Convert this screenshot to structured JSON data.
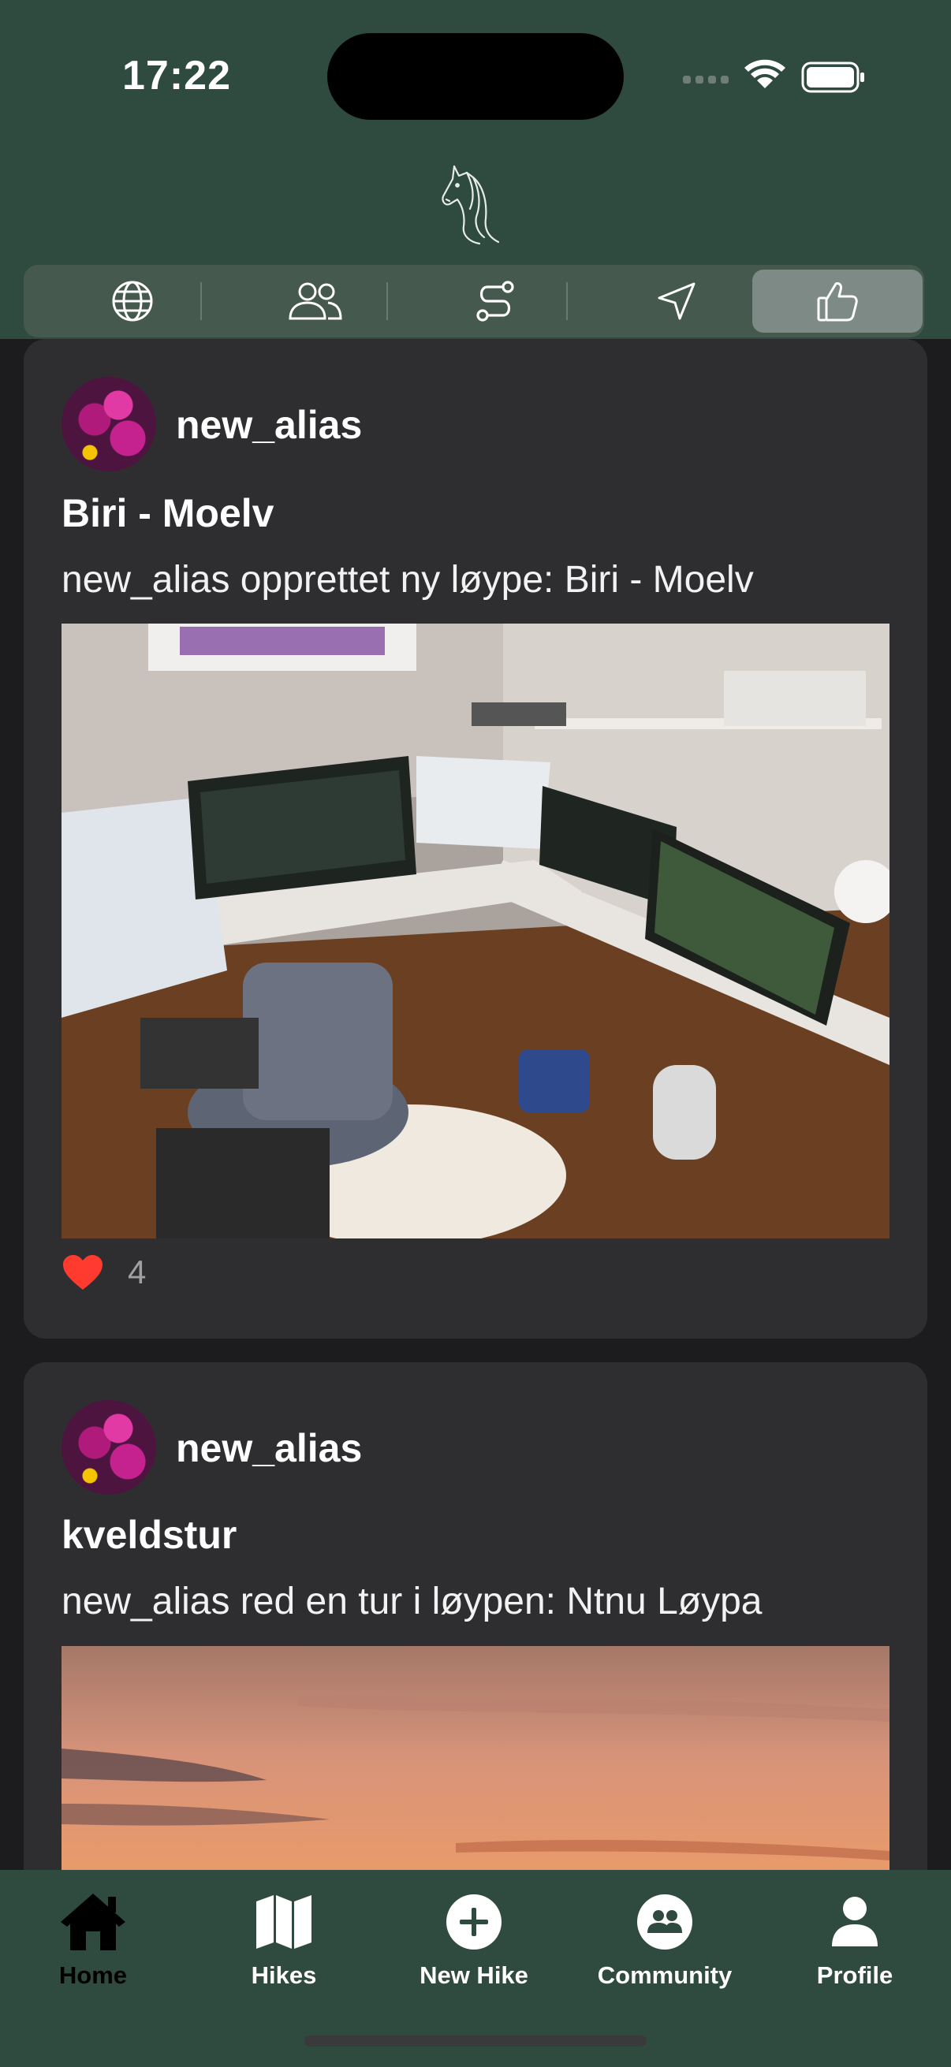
{
  "status_bar": {
    "time": "17:22"
  },
  "filter_tabs": [
    {
      "icon": "globe-icon",
      "selected": false
    },
    {
      "icon": "people-icon",
      "selected": false
    },
    {
      "icon": "route-icon",
      "selected": false
    },
    {
      "icon": "location-arrow-icon",
      "selected": false
    },
    {
      "icon": "thumbs-up-icon",
      "selected": true
    }
  ],
  "posts": [
    {
      "username": "new_alias",
      "title": "Biri - Moelv",
      "description": "new_alias opprettet ny løype: Biri - Moelv",
      "likes": "4"
    },
    {
      "username": "new_alias",
      "title": "kveldstur",
      "description": "new_alias red en tur i løypen: Ntnu Løypa"
    }
  ],
  "tab_bar": {
    "items": [
      {
        "label": "Home",
        "icon": "house-icon",
        "active": true
      },
      {
        "label": "Hikes",
        "icon": "map-icon",
        "active": false
      },
      {
        "label": "New Hike",
        "icon": "plus-circle-icon",
        "active": false
      },
      {
        "label": "Community",
        "icon": "community-icon",
        "active": false
      },
      {
        "label": "Profile",
        "icon": "person-icon",
        "active": false
      }
    ]
  },
  "colors": {
    "header_bg": "#2f4a3f",
    "card_bg": "#2e2e30",
    "page_bg": "#1c1c1e",
    "like_red": "#ff3b30"
  }
}
